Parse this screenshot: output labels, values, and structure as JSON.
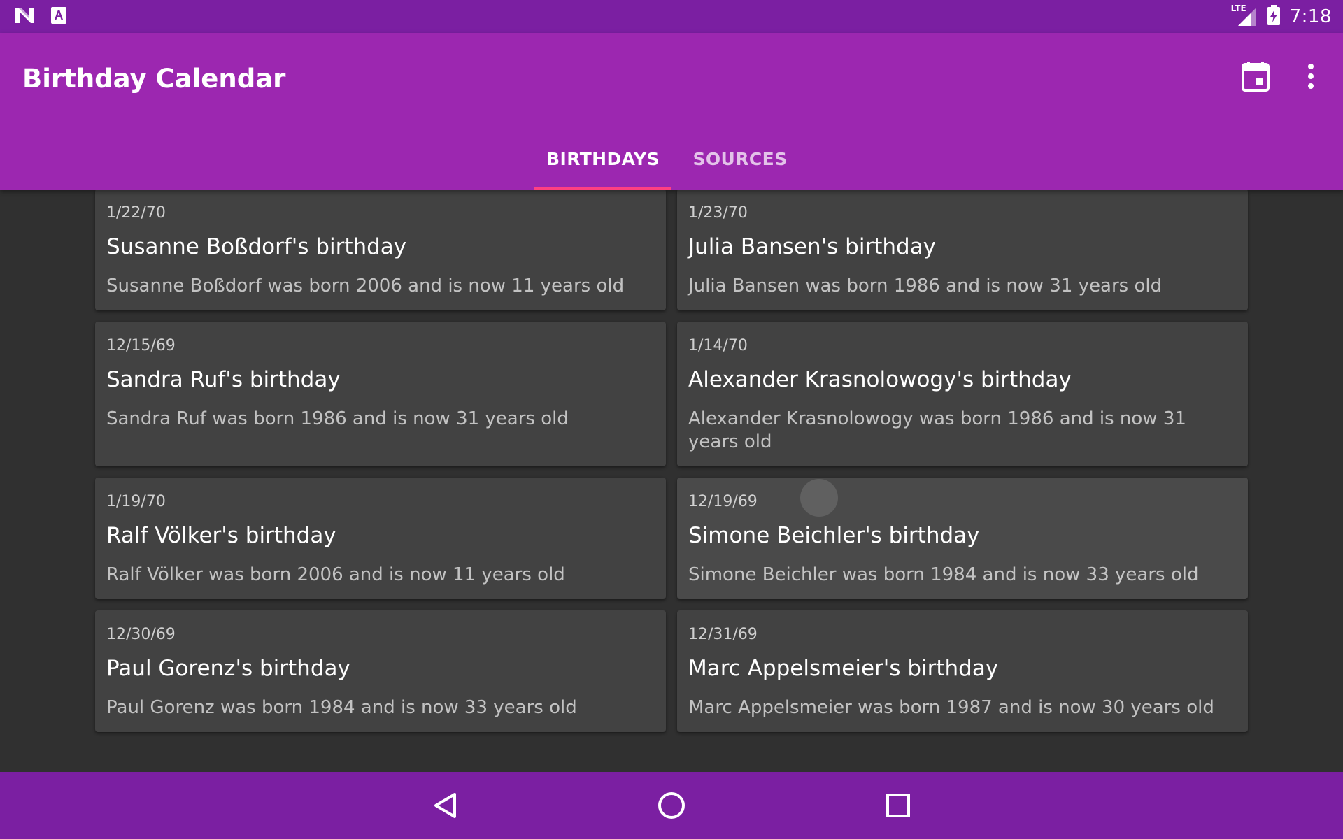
{
  "status_bar": {
    "time": "7:18",
    "network": "LTE",
    "icons": [
      "notification-n-icon",
      "accessibility-a-icon",
      "lte-signal-icon",
      "battery-charging-icon"
    ]
  },
  "app_bar": {
    "title": "Birthday Calendar",
    "actions": [
      "calendar-icon",
      "overflow-menu-icon"
    ],
    "color": "#9C27B0",
    "dark_color": "#7B1FA2",
    "accent": "#FF4081"
  },
  "tabs": [
    {
      "label": "BIRTHDAYS",
      "active": true
    },
    {
      "label": "SOURCES",
      "active": false
    }
  ],
  "birthdays": [
    {
      "date": "1/22/70",
      "title": "Susanne Boßdorf's birthday",
      "subtitle": "Susanne Boßdorf was born 2006 and is now 11 years old"
    },
    {
      "date": "1/23/70",
      "title": "Julia Bansen's birthday",
      "subtitle": "Julia Bansen was born 1986 and is now 31 years old"
    },
    {
      "date": "12/15/69",
      "title": "Sandra Ruf's birthday",
      "subtitle": "Sandra Ruf was born 1986 and is now 31 years old"
    },
    {
      "date": "1/14/70",
      "title": "Alexander Krasnolowogy's birthday",
      "subtitle": "Alexander Krasnolowogy was born 1986 and is now 31 years old"
    },
    {
      "date": "1/19/70",
      "title": "Ralf Völker's birthday",
      "subtitle": "Ralf Völker was born 2006 and is now 11 years old"
    },
    {
      "date": "12/19/69",
      "title": "Simone Beichler's birthday",
      "subtitle": "Simone Beichler was born 1984 and is now 33 years old"
    },
    {
      "date": "12/30/69",
      "title": "Paul Gorenz's birthday",
      "subtitle": "Paul Gorenz was born 1984 and is now 33 years old"
    },
    {
      "date": "12/31/69",
      "title": "Marc Appelsmeier's birthday",
      "subtitle": "Marc Appelsmeier was born 1987 and is now 30 years old"
    }
  ],
  "nav_bar": {
    "buttons": [
      "back-icon",
      "home-icon",
      "recents-icon"
    ]
  }
}
